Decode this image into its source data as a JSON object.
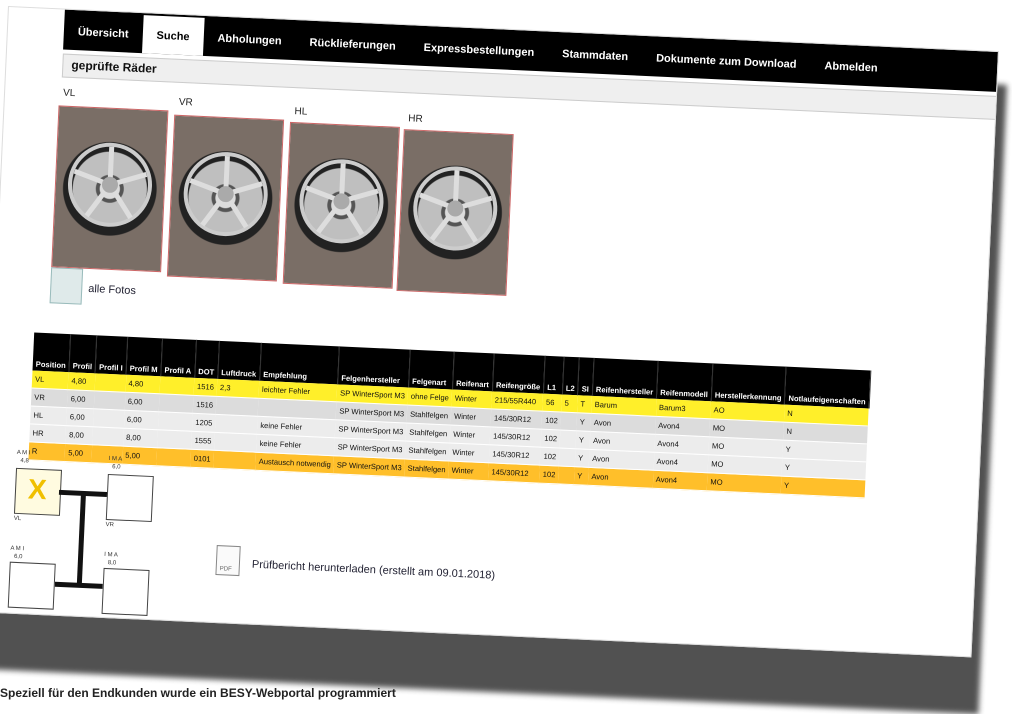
{
  "nav": {
    "items": [
      "Übersicht",
      "Suche",
      "Abholungen",
      "Rücklieferungen",
      "Expressbestellungen",
      "Stammdaten",
      "Dokumente zum Download",
      "Abmelden"
    ],
    "active": "Suche"
  },
  "section": {
    "title": "geprüfte Räder"
  },
  "wheels": {
    "labels": [
      "VL",
      "VR",
      "HL",
      "HR"
    ]
  },
  "fotos_link": "alle Fotos",
  "table": {
    "headers": [
      "Position",
      "Profil",
      "Profil I",
      "Profil M",
      "Profil A",
      "DOT",
      "Luftdruck",
      "Empfehlung",
      "Felgenhersteller",
      "Felgenart",
      "Reifenart",
      "Reifengröße",
      "L1",
      "L2",
      "SI",
      "Reifenhersteller",
      "Reifenmodell",
      "Herstellerkennung",
      "Notlaufeigenschaften"
    ],
    "rows": [
      [
        "VL",
        "4,80",
        "",
        "4,80",
        "",
        "1516",
        "2,3",
        "leichter Fehler",
        "SP WinterSport M3",
        "ohne Felge",
        "Winter",
        "215/55R440",
        "56",
        "5",
        "T",
        "Barum",
        "Barum3",
        "AO",
        "N"
      ],
      [
        "VR",
        "6,00",
        "",
        "6,00",
        "",
        "1516",
        "",
        "",
        "SP WinterSport M3",
        "Stahlfelgen",
        "Winter",
        "145/30R12",
        "102",
        "",
        "Y",
        "Avon",
        "Avon4",
        "MO",
        "N"
      ],
      [
        "HL",
        "6,00",
        "",
        "6,00",
        "",
        "1205",
        "",
        "keine Fehler",
        "SP WinterSport M3",
        "Stahlfelgen",
        "Winter",
        "145/30R12",
        "102",
        "",
        "Y",
        "Avon",
        "Avon4",
        "MO",
        "Y"
      ],
      [
        "HR",
        "8,00",
        "",
        "8,00",
        "",
        "1555",
        "",
        "keine Fehler",
        "SP WinterSport M3",
        "Stahlfelgen",
        "Winter",
        "145/30R12",
        "102",
        "",
        "Y",
        "Avon",
        "Avon4",
        "MO",
        "Y"
      ],
      [
        "R",
        "5,00",
        "",
        "5,00",
        "",
        "0101",
        "",
        "Austausch notwendig",
        "SP WinterSport M3",
        "Stahlfelgen",
        "Winter",
        "145/30R12",
        "102",
        "",
        "Y",
        "Avon",
        "Avon4",
        "MO",
        "Y"
      ]
    ],
    "row_colors": [
      "#ffef2a",
      "#dcdcdc",
      "#ececec",
      "#ececec",
      "#ffbf2a"
    ]
  },
  "axle_diagram": {
    "front_left_tags": "A M I",
    "front_left_value": "4,8",
    "front_right_tags": "I M A",
    "front_right_value": "6,0",
    "rear_left_tags": "A M I",
    "rear_left_value": "6,0",
    "rear_right_tags": "I M A",
    "rear_right_value": "8,0",
    "front_left_mark": "X",
    "front_left_label": "VL",
    "front_right_label": "VR",
    "accent": "#f0c000"
  },
  "pdf": {
    "icon_label": "PDF",
    "link_text": "Prüfbericht herunterladen (erstellt am 09.01.2018)"
  },
  "caption": "Speziell für den Endkunden wurde ein BESY-Webportal programmiert"
}
